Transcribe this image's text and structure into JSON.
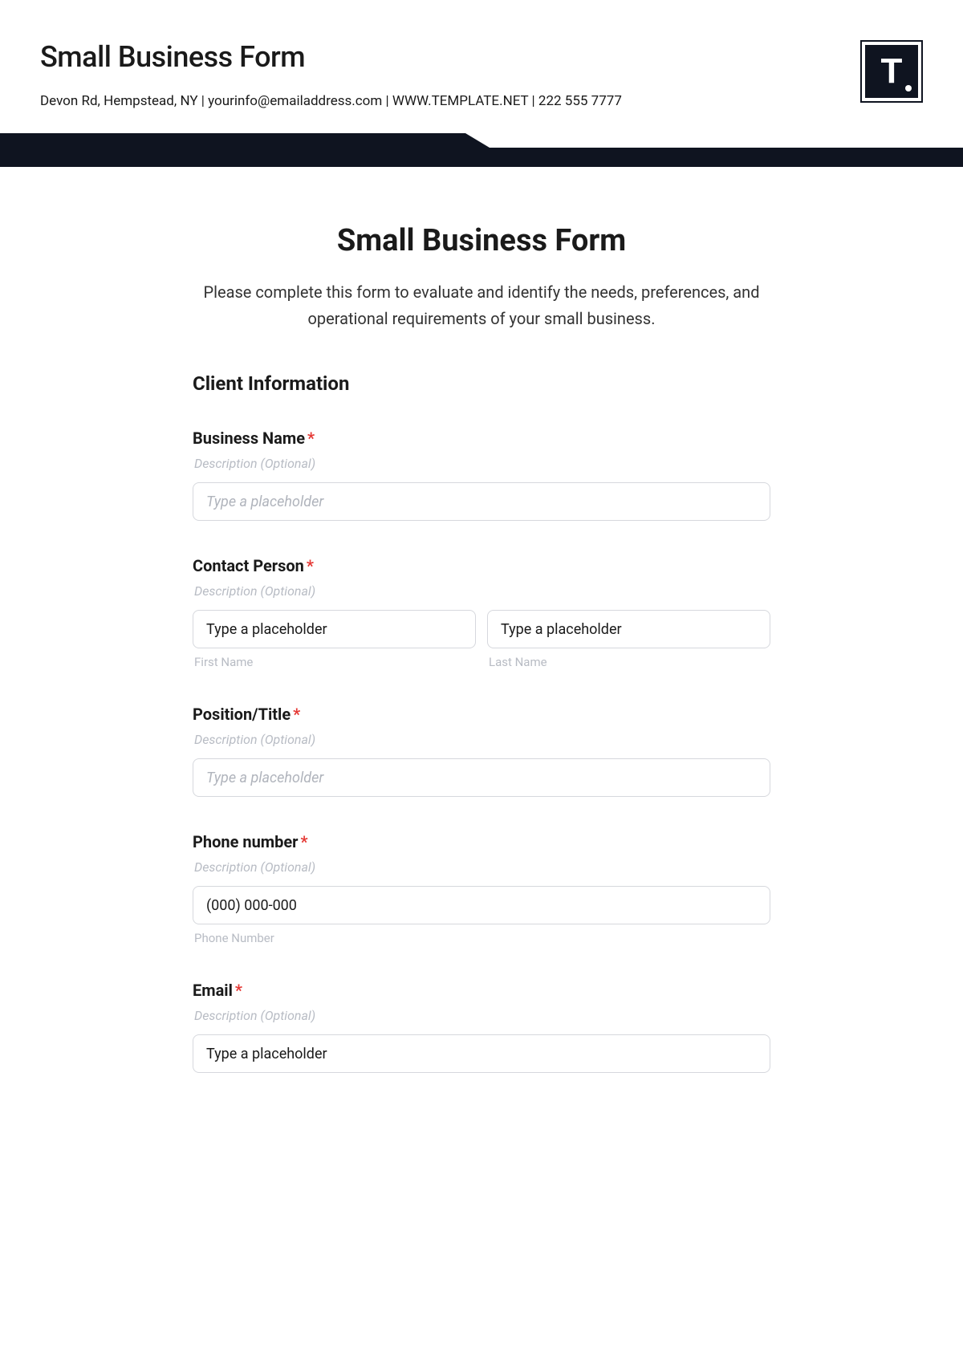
{
  "header": {
    "title": "Small Business Form",
    "contact_line": "Devon Rd, Hempstead, NY | yourinfo@emailaddress.com | WWW.TEMPLATE.NET | 222 555 7777",
    "logo_letter": "T"
  },
  "form": {
    "title": "Small Business Form",
    "intro": "Please complete this form to evaluate and identify the needs, preferences, and operational requirements of your small business.",
    "section1_heading": "Client Information",
    "desc_placeholder": "Description (Optional)",
    "fields": {
      "business_name": {
        "label": "Business Name",
        "placeholder": "Type a placeholder"
      },
      "contact_person": {
        "label": "Contact Person",
        "first_placeholder": "Type a placeholder",
        "last_placeholder": "Type a placeholder",
        "first_sub": "First Name",
        "last_sub": "Last Name"
      },
      "position": {
        "label": "Position/Title",
        "placeholder": "Type a placeholder"
      },
      "phone": {
        "label": "Phone number",
        "placeholder": "(000) 000-000",
        "sub": "Phone Number"
      },
      "email": {
        "label": "Email",
        "placeholder": "Type a placeholder"
      }
    }
  }
}
